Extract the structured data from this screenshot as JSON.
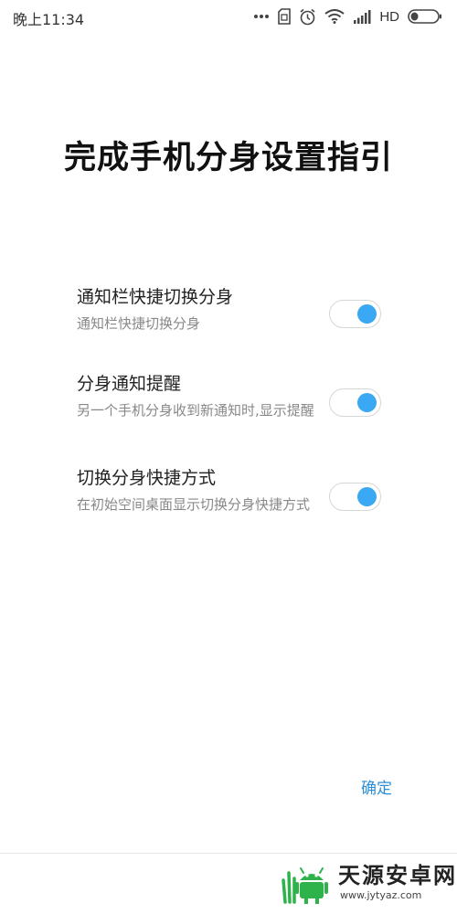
{
  "status_bar": {
    "time": "晚上11:34",
    "network_label": "HD",
    "icons": [
      "more-dots-icon",
      "sim-card-icon",
      "alarm-icon",
      "wifi-icon",
      "signal-icon",
      "battery-icon"
    ]
  },
  "page_title": "完成手机分身设置指引",
  "settings": [
    {
      "title": "通知栏快捷切换分身",
      "description": "通知栏快捷切换分身",
      "enabled": true
    },
    {
      "title": "分身通知提醒",
      "description": "另一个手机分身收到新通知时,显示提醒",
      "enabled": true
    },
    {
      "title": "切换分身快捷方式",
      "description": "在初始空间桌面显示切换分身快捷方式",
      "enabled": true
    }
  ],
  "confirm_label": "确定",
  "watermark": {
    "name": "天源安卓网",
    "url": "www.jytyaz.com"
  },
  "colors": {
    "accent": "#3aa8f2",
    "link": "#2a8fd6",
    "title_text": "#111111",
    "desc_text": "#888888",
    "watermark_green": "#2db34a"
  }
}
